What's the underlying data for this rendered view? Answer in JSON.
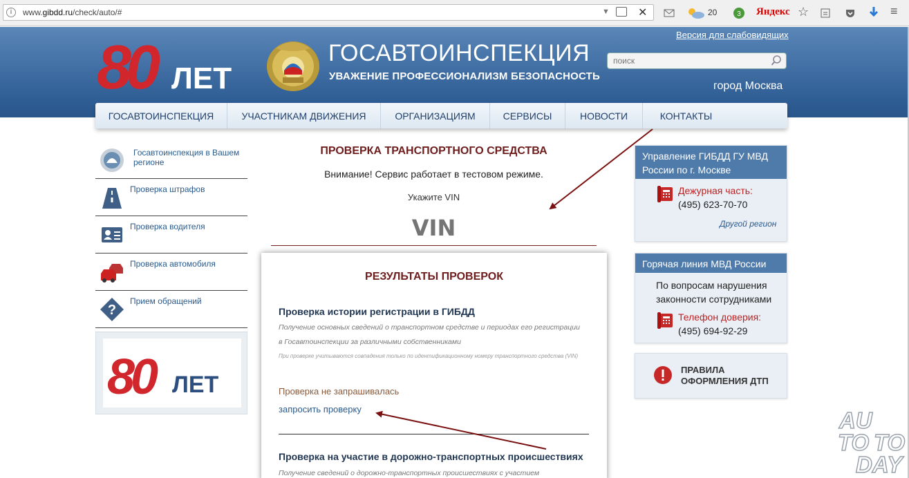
{
  "browser": {
    "url_prefix": "www.",
    "url_domain": "gibdd.ru",
    "url_path": "/check/auto/#",
    "weather_temp": "20",
    "ext_badge": "3",
    "yandex": "Яндекс"
  },
  "header": {
    "logo_text_number": "80",
    "logo_text_word": "ЛЕТ",
    "title": "ГОСАВТОИНСПЕКЦИЯ",
    "subtitle": "УВАЖЕНИЕ ПРОФЕССИОНАЛИЗМ БЕЗОПАСНОСТЬ",
    "accessibility_link": "Версия для слабовидящих",
    "search_placeholder": "поиск",
    "city": "город Москва"
  },
  "nav": {
    "items": [
      {
        "label": "ГОСАВТОИНСПЕКЦИЯ"
      },
      {
        "label": "УЧАСТНИКАМ ДВИЖЕНИЯ"
      },
      {
        "label": "ОРГАНИЗАЦИЯМ"
      },
      {
        "label": "СЕРВИСЫ"
      },
      {
        "label": "НОВОСТИ"
      },
      {
        "label": "КОНТАКТЫ"
      }
    ]
  },
  "sidebar": {
    "items": [
      {
        "label": "Госавтоинспекция в Вашем регионе",
        "icon": "emblem-icon"
      },
      {
        "label": "Проверка штрафов",
        "icon": "road-icon"
      },
      {
        "label": "Проверка водителя",
        "icon": "id-card-icon"
      },
      {
        "label": "Проверка автомобиля",
        "icon": "cars-icon"
      },
      {
        "label": "Прием обращений",
        "icon": "question-icon"
      }
    ],
    "banner_number": "80",
    "banner_word": "ЛЕТ"
  },
  "main": {
    "title": "ПРОВЕРКА ТРАНСПОРТНОГО СРЕДСТВА",
    "notice": "Внимание! Сервис работает в тестовом режиме.",
    "vin_label": "Укажите VIN",
    "vin_placeholder": "VIN"
  },
  "results": {
    "title": "РЕЗУЛЬТАТЫ ПРОВЕРОК",
    "section1": {
      "title": "Проверка истории регистрации в ГИБДД",
      "desc": "Получение основных сведений о транспортном средстве и периодах его регистрации в Госавтоинспекции за различными собственниками",
      "note": "При проверке учитываются совпадения только по идентификационному номеру транспортного средства (VIN)",
      "status": "Проверка не запрашивалась",
      "action": "запросить проверку"
    },
    "section2": {
      "title": "Проверка на участие в дорожно-транспортных происшествиях",
      "desc": "Получение сведений о дорожно-транспортных происшествиях с участием"
    }
  },
  "right": {
    "box1": {
      "title": "Управление ГИБДД ГУ МВД России по г. Москве",
      "phone_label": "Дежурная часть:",
      "phone": "(495) 623-70-70",
      "link": "Другой регион"
    },
    "box2": {
      "title": "Горячая линия МВД России",
      "text": "По вопросам нарушения законности сотрудниками",
      "phone_label": "Телефон доверия:",
      "phone": "(495) 694-92-29"
    },
    "dtp": "ПРАВИЛА ОФОРМЛЕНИЯ ДТП"
  },
  "watermark": {
    "line1": "AU",
    "line2": "TO",
    "line3": "TO",
    "line4": "DAY"
  },
  "colors": {
    "header_blue": "#2f5e95",
    "accent_red": "#6e1c1c",
    "link_blue": "#2a5a8c",
    "logo_red": "#d0262c"
  }
}
